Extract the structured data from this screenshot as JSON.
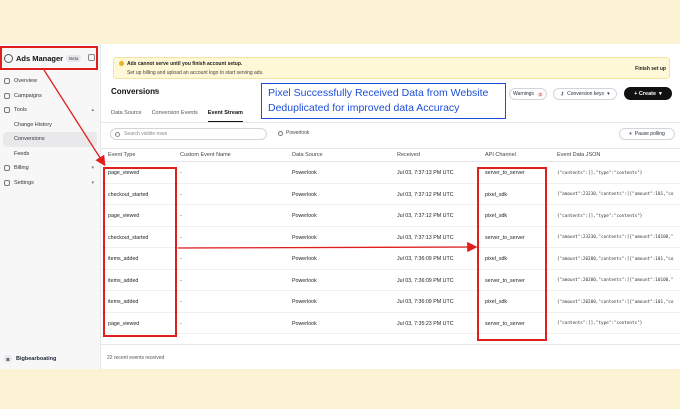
{
  "app": {
    "name": "Ads Manager",
    "badge": "Beta"
  },
  "sidebar": {
    "items": [
      {
        "label": "Overview"
      },
      {
        "label": "Campaigns"
      },
      {
        "label": "Tools"
      },
      {
        "label": "Change History"
      },
      {
        "label": "Conversions"
      },
      {
        "label": "Feeds"
      },
      {
        "label": "Billing"
      },
      {
        "label": "Settings"
      }
    ],
    "account": {
      "name": "Bigbearboating",
      "initial": "B"
    }
  },
  "banner": {
    "title": "Ads cannot serve until you finish account setup.",
    "message": "Set up billing and upload an account logo to start serving ads.",
    "action": "Finish set up"
  },
  "page": {
    "title": "Conversions"
  },
  "toolbar": {
    "warnings_label": "Warnings",
    "warnings_count": "3",
    "conversion_keys_label": "Conversion keys",
    "create_label": "+ Create"
  },
  "tabs": [
    {
      "label": "Data Source"
    },
    {
      "label": "Conversion Events"
    },
    {
      "label": "Event Stream"
    }
  ],
  "filter": {
    "search_placeholder": "Search visible rows",
    "pixel_label": "Powerlook",
    "pause_label": "Pause polling"
  },
  "table": {
    "columns": [
      "Event Type",
      "Custom Event Name",
      "Data Source",
      "Received",
      "API Channel",
      "Event Data JSON"
    ],
    "rows": [
      {
        "event_type": "page_viewed",
        "custom_event_name": "-",
        "data_source": "Powerlook",
        "received": "Jul 03, 7:37:13 PM UTC",
        "api_channel": "server_to_server",
        "json": "{\"contents\":[],\"type\":\"contents\"}"
      },
      {
        "event_type": "checkout_started",
        "custom_event_name": "-",
        "data_source": "Powerlook",
        "received": "Jul 03, 7:37:12 PM UTC",
        "api_channel": "pixel_sdk",
        "json": "{\"amount\":23230,\"contents\":[{\"amount\":101,\"co"
      },
      {
        "event_type": "page_viewed",
        "custom_event_name": "-",
        "data_source": "Powerlook",
        "received": "Jul 03, 7:37:12 PM UTC",
        "api_channel": "pixel_sdk",
        "json": "{\"contents\":[],\"type\":\"contents\"}"
      },
      {
        "event_type": "checkout_started",
        "custom_event_name": "-",
        "data_source": "Powerlook",
        "received": "Jul 03, 7:37:13 PM UTC",
        "api_channel": "server_to_server",
        "json": "{\"amount\":23230,\"contents\":[{\"amount\":10100,\""
      },
      {
        "event_type": "items_added",
        "custom_event_name": "-",
        "data_source": "Powerlook",
        "received": "Jul 03, 7:36:09 PM UTC",
        "api_channel": "pixel_sdk",
        "json": "{\"amount\":20200,\"contents\":[{\"amount\":101,\"co"
      },
      {
        "event_type": "items_added",
        "custom_event_name": "-",
        "data_source": "Powerlook",
        "received": "Jul 03, 7:36:09 PM UTC",
        "api_channel": "server_to_server",
        "json": "{\"amount\":20200,\"contents\":[{\"amount\":10100,\""
      },
      {
        "event_type": "items_added",
        "custom_event_name": "-",
        "data_source": "Powerlook",
        "received": "Jul 03, 7:36:09 PM UTC",
        "api_channel": "pixel_sdk",
        "json": "{\"amount\":20200,\"contents\":[{\"amount\":101,\"co"
      },
      {
        "event_type": "page_viewed",
        "custom_event_name": "-",
        "data_source": "Powerlook",
        "received": "Jul 03, 7:35:23 PM UTC",
        "api_channel": "server_to_server",
        "json": "{\"contents\":[],\"type\":\"contents\"}"
      }
    ]
  },
  "footer": {
    "count_text": "22 recent events received"
  },
  "annotation": {
    "line1": "Pixel Successfully Received Data from Website",
    "line2": "Deduplicated for improved data Accuracy",
    "color": "#e11d1d",
    "text_color": "#1d4ed8"
  }
}
